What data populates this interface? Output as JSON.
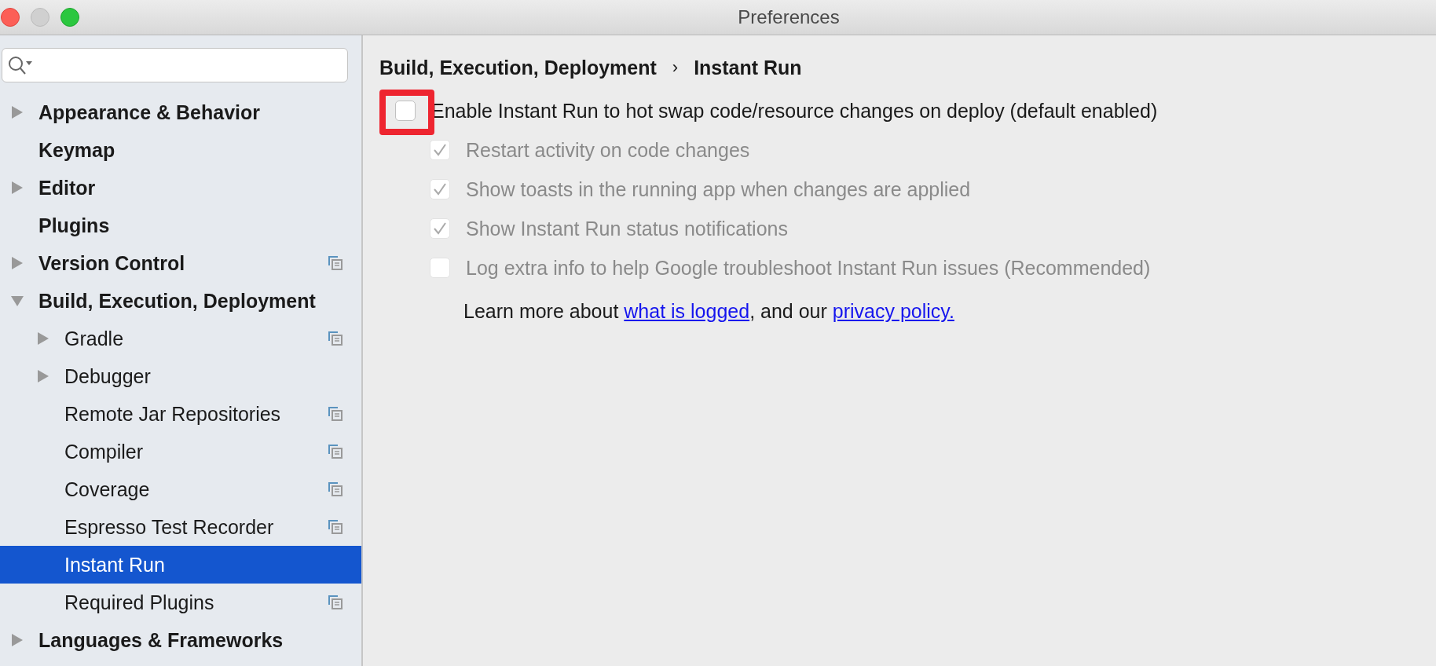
{
  "window": {
    "title": "Preferences"
  },
  "sidebar": {
    "items": [
      {
        "label": "Appearance & Behavior",
        "kind": "group",
        "expanded": false,
        "selected": false,
        "project_level": false
      },
      {
        "label": "Keymap",
        "kind": "page",
        "selected": false,
        "project_level": false
      },
      {
        "label": "Editor",
        "kind": "group",
        "expanded": false,
        "selected": false,
        "project_level": false
      },
      {
        "label": "Plugins",
        "kind": "page",
        "selected": false,
        "project_level": false
      },
      {
        "label": "Version Control",
        "kind": "group",
        "expanded": false,
        "selected": false,
        "project_level": true
      },
      {
        "label": "Build, Execution, Deployment",
        "kind": "group",
        "expanded": true,
        "selected": false,
        "project_level": false,
        "children": [
          {
            "label": "Gradle",
            "kind": "group",
            "expanded": false,
            "selected": false,
            "project_level": true
          },
          {
            "label": "Debugger",
            "kind": "group",
            "expanded": false,
            "selected": false,
            "project_level": false
          },
          {
            "label": "Remote Jar Repositories",
            "kind": "page",
            "selected": false,
            "project_level": true
          },
          {
            "label": "Compiler",
            "kind": "page",
            "selected": false,
            "project_level": true
          },
          {
            "label": "Coverage",
            "kind": "page",
            "selected": false,
            "project_level": true
          },
          {
            "label": "Espresso Test Recorder",
            "kind": "page",
            "selected": false,
            "project_level": true
          },
          {
            "label": "Instant Run",
            "kind": "page",
            "selected": true,
            "project_level": false
          },
          {
            "label": "Required Plugins",
            "kind": "page",
            "selected": false,
            "project_level": true
          }
        ]
      },
      {
        "label": "Languages & Frameworks",
        "kind": "group",
        "expanded": false,
        "selected": false,
        "project_level": false
      }
    ]
  },
  "breadcrumb": {
    "parent": "Build, Execution, Deployment",
    "separator": "›",
    "current": "Instant Run"
  },
  "main_option": {
    "label": "Enable Instant Run to hot swap code/resource changes on deploy (default enabled)",
    "checked": false,
    "highlighted": true
  },
  "sub_options": [
    {
      "label": "Restart activity on code changes",
      "checked": true,
      "disabled": true
    },
    {
      "label": "Show toasts in the running app when changes are applied",
      "checked": true,
      "disabled": true
    },
    {
      "label": "Show Instant Run status notifications",
      "checked": true,
      "disabled": true
    },
    {
      "label": "Log extra info to help Google troubleshoot Instant Run issues (Recommended)",
      "checked": false,
      "disabled": true
    }
  ],
  "note": {
    "before": "Learn more about ",
    "link1": "what is logged",
    "middle": ", and our ",
    "link2": "privacy policy."
  }
}
